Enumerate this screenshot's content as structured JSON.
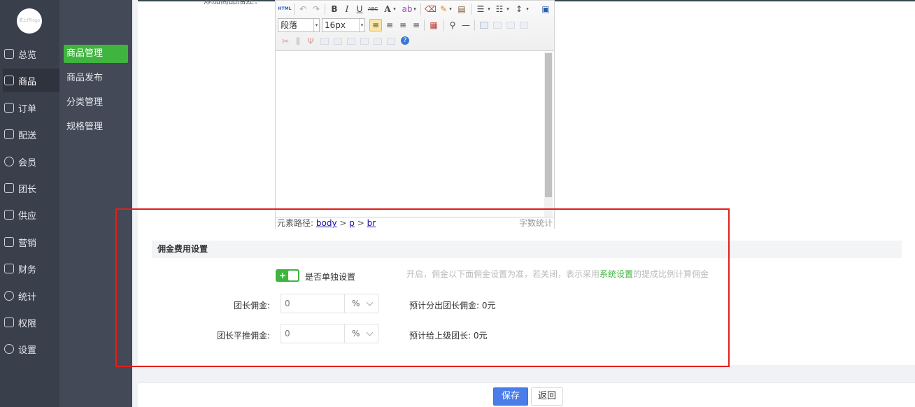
{
  "sidebar": {
    "logo_text": "请上传logo",
    "items": [
      {
        "label": "总览",
        "icon": "home-icon"
      },
      {
        "label": "商品",
        "icon": "bag-icon"
      },
      {
        "label": "订单",
        "icon": "order-icon"
      },
      {
        "label": "配送",
        "icon": "delivery-icon"
      },
      {
        "label": "会员",
        "icon": "user-icon"
      },
      {
        "label": "团长",
        "icon": "leader-icon"
      },
      {
        "label": "供应",
        "icon": "store-icon"
      },
      {
        "label": "营销",
        "icon": "gift-icon"
      },
      {
        "label": "财务",
        "icon": "finance-icon"
      },
      {
        "label": "统计",
        "icon": "chart-icon"
      },
      {
        "label": "权限",
        "icon": "shield-icon"
      },
      {
        "label": "设置",
        "icon": "gear-icon"
      }
    ],
    "active": "商品"
  },
  "subnav": {
    "items": [
      "商品管理",
      "商品发布",
      "分类管理",
      "规格管理"
    ],
    "active": "商品管理"
  },
  "form": {
    "description_label": "添加商品描述："
  },
  "editor": {
    "toolbar": {
      "html_label": "HTML",
      "bold": "B",
      "italic": "I",
      "underline": "U",
      "strike": "ABC",
      "font_color": "A",
      "paragraph": "段落",
      "font_size": "16px"
    },
    "status": {
      "path_label": "元素路径:",
      "path": [
        "body",
        "p",
        "br"
      ],
      "separator": ">",
      "word_count": "字数统计"
    }
  },
  "commission": {
    "section_title": "佣金费用设置",
    "toggle_label": "是否单独设置",
    "hint_prefix": "开启，佣金以下面佣金设置为准，若关闭，表示采用",
    "hint_link": "系统设置",
    "hint_suffix": "的提成比例计算佣金",
    "leader_label": "团长佣金:",
    "leader_value": "0",
    "leader_unit": "%",
    "leader_estimate": "预计分出团长佣金: 0元",
    "referral_label": "团长平推佣金:",
    "referral_value": "0",
    "referral_unit": "%",
    "referral_estimate": "预计给上级团长: 0元"
  },
  "footer": {
    "save": "保存",
    "back": "返回"
  },
  "colors": {
    "accent_green": "#3fb53f",
    "primary_blue": "#4a7de8",
    "highlight_red": "#e0201c",
    "sidebar_bg": "#3a3f4c"
  }
}
